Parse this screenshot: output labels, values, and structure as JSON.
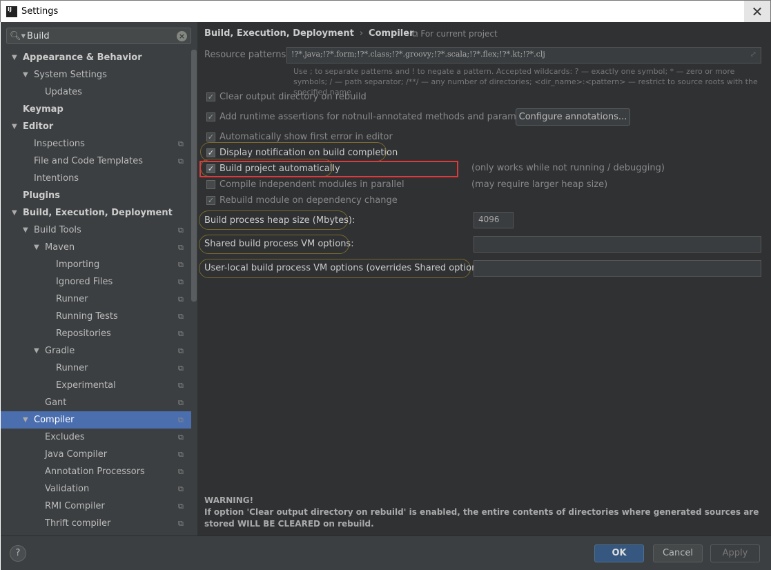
{
  "window": {
    "title": "Settings",
    "logo": "IJ"
  },
  "search": {
    "value": "Build"
  },
  "tree": [
    {
      "label": "Appearance & Behavior",
      "level": 0,
      "arrow": true,
      "bold": true,
      "copy": false
    },
    {
      "label": "System Settings",
      "level": 1,
      "arrow": true,
      "bold": false,
      "copy": false
    },
    {
      "label": "Updates",
      "level": 2,
      "arrow": false,
      "bold": false,
      "copy": false
    },
    {
      "label": "Keymap",
      "level": 0,
      "arrow": false,
      "bold": true,
      "copy": false
    },
    {
      "label": "Editor",
      "level": 0,
      "arrow": true,
      "bold": true,
      "copy": false
    },
    {
      "label": "Inspections",
      "level": 1,
      "arrow": false,
      "bold": false,
      "copy": true
    },
    {
      "label": "File and Code Templates",
      "level": 1,
      "arrow": false,
      "bold": false,
      "copy": true
    },
    {
      "label": "Intentions",
      "level": 1,
      "arrow": false,
      "bold": false,
      "copy": false
    },
    {
      "label": "Plugins",
      "level": 0,
      "arrow": false,
      "bold": true,
      "copy": false
    },
    {
      "label": "Build, Execution, Deployment",
      "level": 0,
      "arrow": true,
      "bold": true,
      "copy": false
    },
    {
      "label": "Build Tools",
      "level": 1,
      "arrow": true,
      "bold": false,
      "copy": true
    },
    {
      "label": "Maven",
      "level": 2,
      "arrow": true,
      "bold": false,
      "copy": true
    },
    {
      "label": "Importing",
      "level": 3,
      "arrow": false,
      "bold": false,
      "copy": true
    },
    {
      "label": "Ignored Files",
      "level": 3,
      "arrow": false,
      "bold": false,
      "copy": true
    },
    {
      "label": "Runner",
      "level": 3,
      "arrow": false,
      "bold": false,
      "copy": true
    },
    {
      "label": "Running Tests",
      "level": 3,
      "arrow": false,
      "bold": false,
      "copy": true
    },
    {
      "label": "Repositories",
      "level": 3,
      "arrow": false,
      "bold": false,
      "copy": true
    },
    {
      "label": "Gradle",
      "level": 2,
      "arrow": true,
      "bold": false,
      "copy": true
    },
    {
      "label": "Runner",
      "level": 3,
      "arrow": false,
      "bold": false,
      "copy": true
    },
    {
      "label": "Experimental",
      "level": 3,
      "arrow": false,
      "bold": false,
      "copy": true
    },
    {
      "label": "Gant",
      "level": 2,
      "arrow": false,
      "bold": false,
      "copy": true
    },
    {
      "label": "Compiler",
      "level": 1,
      "arrow": true,
      "bold": false,
      "copy": true,
      "selected": true
    },
    {
      "label": "Excludes",
      "level": 2,
      "arrow": false,
      "bold": false,
      "copy": true
    },
    {
      "label": "Java Compiler",
      "level": 2,
      "arrow": false,
      "bold": false,
      "copy": true
    },
    {
      "label": "Annotation Processors",
      "level": 2,
      "arrow": false,
      "bold": false,
      "copy": true
    },
    {
      "label": "Validation",
      "level": 2,
      "arrow": false,
      "bold": false,
      "copy": true
    },
    {
      "label": "RMI Compiler",
      "level": 2,
      "arrow": false,
      "bold": false,
      "copy": true
    },
    {
      "label": "Thrift compiler",
      "level": 2,
      "arrow": false,
      "bold": false,
      "copy": true
    }
  ],
  "main": {
    "breadcrumb": [
      "Build, Execution, Deployment",
      "Compiler"
    ],
    "for_project": "For current project",
    "resource_label": "Resource patterns:",
    "resource_value": "!?*.java;!?*.form;!?*.class;!?*.groovy;!?*.scala;!?*.flex;!?*.kt;!?*.clj",
    "hint": "Use ; to separate patterns and ! to negate a pattern. Accepted wildcards: ? — exactly one symbol; * — zero or more symbols; / — path separator; /**/ — any number of directories; <dir_name>:<pattern> — restrict to source roots with the specified name",
    "checkboxes": [
      {
        "label": "Clear output directory on rebuild",
        "checked": true,
        "enabled": false
      },
      {
        "label": "Add runtime assertions for notnull-annotated methods and parameters",
        "checked": true,
        "enabled": false
      },
      {
        "label": "Automatically show first error in editor",
        "checked": true,
        "enabled": false
      },
      {
        "label": "Display notification on build completion",
        "checked": true,
        "enabled": true
      },
      {
        "label": "Build project automatically",
        "checked": true,
        "enabled": true
      },
      {
        "label": "Compile independent modules in parallel",
        "checked": false,
        "enabled": false
      },
      {
        "label": "Rebuild module on dependency change",
        "checked": true,
        "enabled": false
      }
    ],
    "configure_button": "Configure annotations...",
    "note_auto": "(only works while not running / debugging)",
    "note_parallel": "(may require larger heap size)",
    "heap_label": "Build process heap size (Mbytes):",
    "heap_value": "4096",
    "shared_label": "Shared build process VM options:",
    "shared_value": "",
    "user_label": "User-local build process VM options (overrides Shared options):",
    "user_value": "",
    "warning_title": "WARNING!",
    "warning_text": "If option 'Clear output directory on rebuild' is enabled, the entire contents of directories where generated sources are stored WILL BE CLEARED on rebuild."
  },
  "footer": {
    "help": "?",
    "ok": "OK",
    "cancel": "Cancel",
    "apply": "Apply"
  },
  "colors": {
    "selection": "#4b6eaf",
    "highlight_box": "#e0393a",
    "annotation_ring": "#7a6830"
  }
}
